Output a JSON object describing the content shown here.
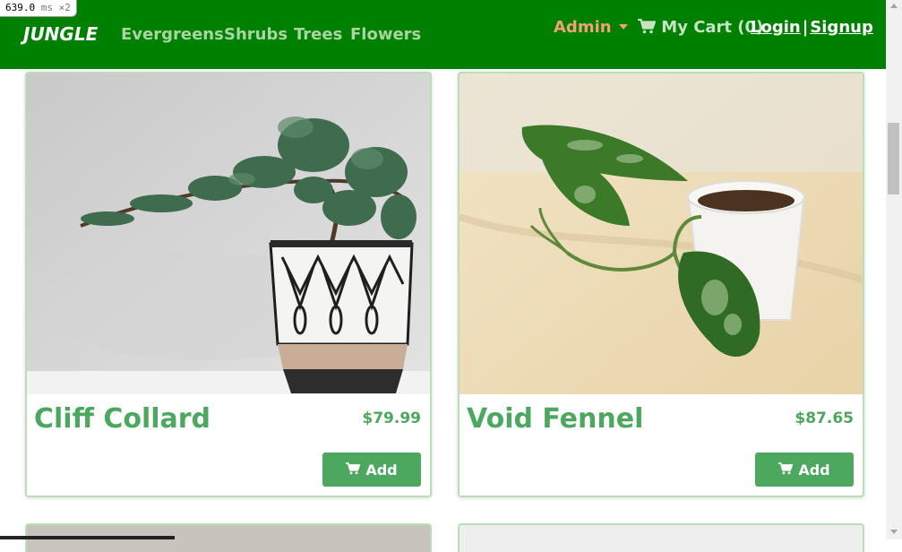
{
  "timer": {
    "value": "639.0",
    "unit": "ms",
    "multiplier": "×2"
  },
  "navbar": {
    "brand": "JUNGLE",
    "links": [
      "Evergreens",
      "Shrubs",
      "Trees",
      "Flowers"
    ],
    "admin_label": "Admin",
    "cart_label": "My Cart (0)",
    "login_label": "Login",
    "separator": "|",
    "signup_label": "Signup"
  },
  "products": [
    {
      "name": "Cliff Collard",
      "price": "$79.99",
      "add_label": "Add",
      "image": "bonsai-plant-in-patterned-pot"
    },
    {
      "name": "Void Fennel",
      "price": "$87.65",
      "add_label": "Add",
      "image": "pothos-cutting-in-white-pot"
    }
  ],
  "colors": {
    "navbar": "#008000",
    "accent": "#4ca85f",
    "admin": "#f0a07a",
    "card_border": "#b7e0b5"
  }
}
